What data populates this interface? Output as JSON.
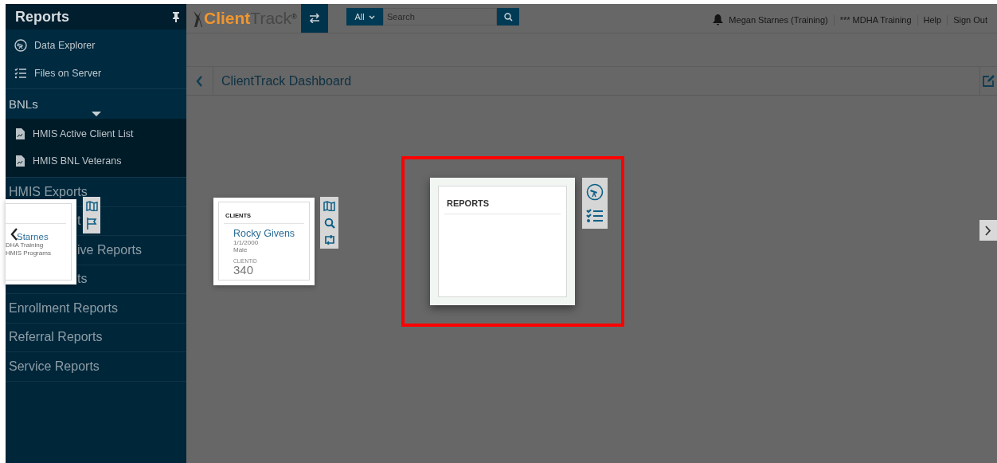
{
  "sidebar": {
    "title": "Reports",
    "top_items": [
      {
        "label": "Data Explorer",
        "kind": "explorer"
      },
      {
        "label": "Files on Server",
        "kind": "checklist"
      }
    ],
    "sections": [
      {
        "label": "BNLs",
        "expanded": true,
        "children": [
          {
            "label": "HMIS Active Client List"
          },
          {
            "label": "HMIS BNL Veterans"
          }
        ]
      },
      {
        "label": "HMIS Exports",
        "kind": "plain"
      },
      {
        "label": "t",
        "kind": "covered"
      },
      {
        "label": "ive Reports",
        "kind": "covered"
      },
      {
        "label": "ts",
        "kind": "covered"
      },
      {
        "label": "Enrollment Reports",
        "kind": "plain"
      },
      {
        "label": "Referral Reports",
        "kind": "plain"
      },
      {
        "label": "Service Reports",
        "kind": "plain"
      }
    ]
  },
  "header": {
    "logo": {
      "part_1": "Client",
      "part_2": "Track",
      "mark": "®"
    },
    "search": {
      "scope": "All",
      "placeholder": "Search"
    },
    "links": [
      "Megan Starnes (Training)",
      "*** MDHA Training",
      "Help",
      "Sign Out"
    ]
  },
  "page_title": "ClientTrack Dashboard",
  "widgets": [
    {
      "kind": "person",
      "name": "Starnes",
      "lines": [
        "DHA Training",
        "HMIS Programs"
      ],
      "actions": [
        {
          "kind": "map"
        },
        {
          "kind": "flag"
        }
      ]
    },
    {
      "kind": "client",
      "title": "CLIENTS",
      "name": "Rocky Givens",
      "lines": [
        "1/1/2000",
        "Male"
      ],
      "id_label": "CLIENTID",
      "id": "340",
      "actions": [
        {
          "kind": "map"
        },
        {
          "kind": "search"
        },
        {
          "kind": "swap"
        }
      ]
    },
    {
      "kind": "reports",
      "title": "REPORTS",
      "highlighted": true,
      "actions": [
        {
          "kind": "telescope"
        },
        {
          "kind": "checklist"
        }
      ]
    }
  ]
}
